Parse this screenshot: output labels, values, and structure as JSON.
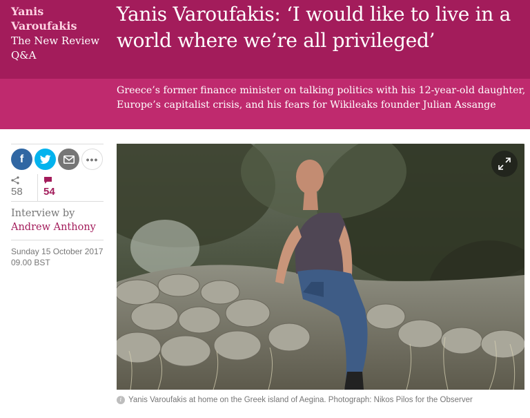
{
  "header": {
    "kicker_name": "Yanis Varoufakis",
    "kicker_series": "The New Review Q&A",
    "headline": "Yanis Varoufakis: ‘I would like to live in a world where we’re all privileged’",
    "standfirst": "Greece’s former finance minister on talking politics with his 12-year-old daughter, Europe’s capitalist crisis, and his fears for Wikileaks founder Julian Assange"
  },
  "share": {
    "facebook_icon": "f",
    "more_icon": "•••"
  },
  "counts": {
    "shares": "58",
    "comments": "54"
  },
  "byline": {
    "label": "Interview by",
    "author": "Andrew Anthony"
  },
  "dateline": {
    "date": "Sunday 15 October 2017",
    "time": "09.00 BST"
  },
  "caption": {
    "info_icon": "i",
    "text": "Yanis Varoufakis at home on the Greek island of Aegina. Photograph: Nikos Pilos for the Observer"
  },
  "colors": {
    "header_dark": "#a31c5b",
    "header_light": "#bf2a6e",
    "kicker": "#ffd2e2",
    "facebook": "#3067a3",
    "twitter": "#03b3ee",
    "email": "#767676"
  }
}
